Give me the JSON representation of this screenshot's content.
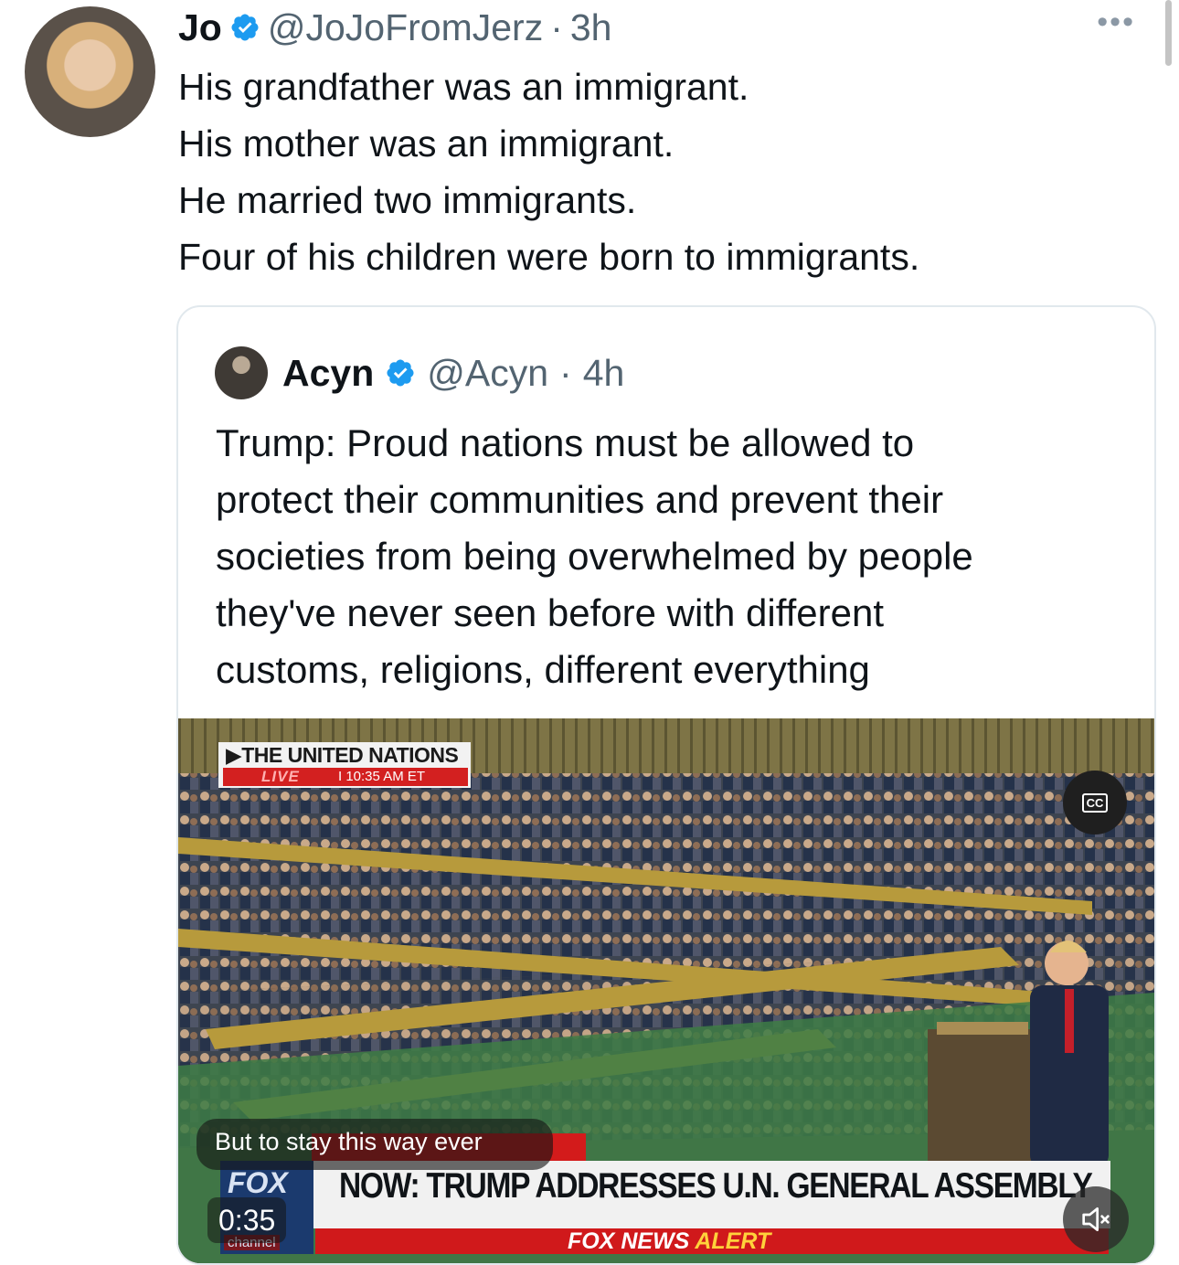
{
  "tweet": {
    "author": {
      "name": "Jo",
      "handle": "@JoJoFromJerz",
      "separator": "·",
      "time": "3h",
      "verified": true
    },
    "lines": [
      "His grandfather was an immigrant.",
      "His mother was an immigrant.",
      "He married two immigrants.",
      "Four of his children were born to immigrants."
    ],
    "more_icon": "more-horizontal-icon"
  },
  "quoted_tweet": {
    "author": {
      "name": "Acyn",
      "handle": "@Acyn",
      "separator": "·",
      "time": "4h",
      "verified": true
    },
    "lines": [
      "Trump: Proud nations must be allowed to",
      "protect their communities and prevent their",
      "societies from being overwhelmed by people",
      "they've never seen before with different",
      "customs, religions, different everything"
    ],
    "video": {
      "top_tag_title": "▶THE UNITED NATIONS",
      "top_tag_live": "LIVE",
      "top_tag_time": "I  10:35 AM ET",
      "cc_label": "CC",
      "caption_text": "But to stay this way ever",
      "duration": "0:35",
      "chyron_headline": "NOW: TRUMP ADDRESSES U.N. GENERAL ASSEMBLY",
      "chyron_alert_prefix": "FOX NEWS",
      "chyron_alert_suffix": "ALERT",
      "logo_text": "FOX",
      "logo_sub": "channel",
      "mute_icon": "volume-muted-icon"
    }
  },
  "colors": {
    "verified": "#1d9bf0",
    "secondary_text": "#536471",
    "fox_red": "#d0191b",
    "fox_blue": "#1b3a6e"
  }
}
